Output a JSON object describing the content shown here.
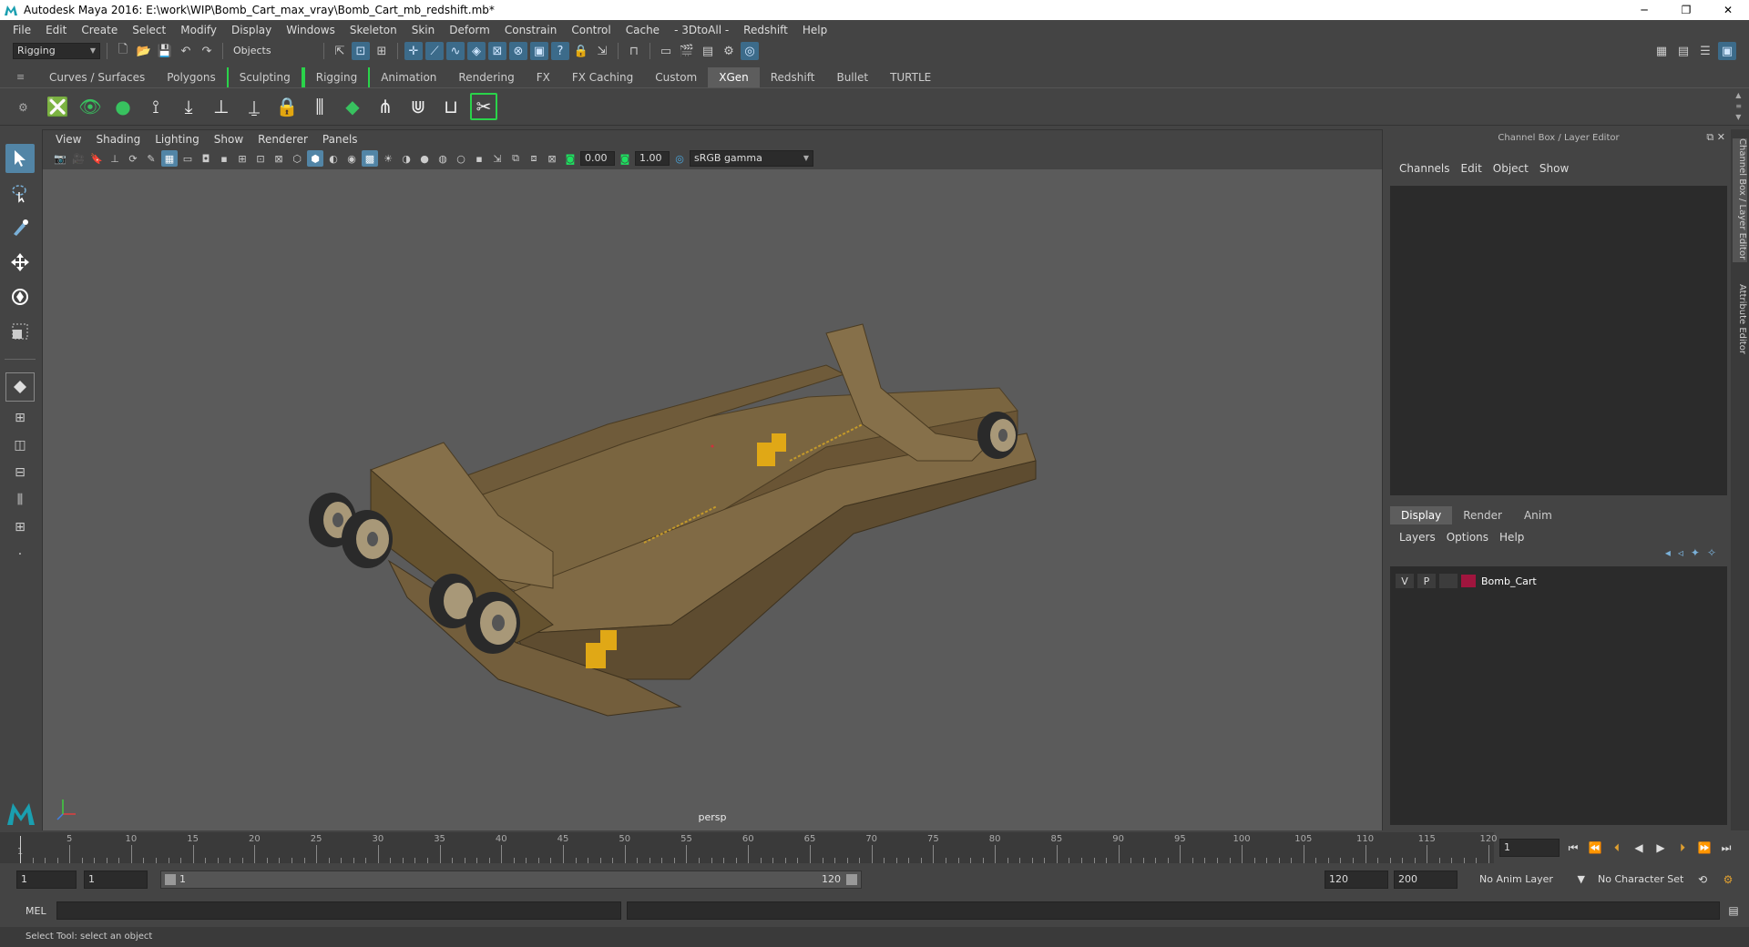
{
  "window": {
    "title": "Autodesk Maya 2016: E:\\work\\WIP\\Bomb_Cart_max_vray\\Bomb_Cart_mb_redshift.mb*",
    "minimize": "─",
    "restore": "❐",
    "close": "✕"
  },
  "menubar": [
    "File",
    "Edit",
    "Create",
    "Select",
    "Modify",
    "Display",
    "Windows",
    "Skeleton",
    "Skin",
    "Deform",
    "Constrain",
    "Control",
    "Cache",
    "- 3DtoAll -",
    "Redshift",
    "Help"
  ],
  "statusline": {
    "menuset": "Rigging",
    "selection_mode": "Objects"
  },
  "shelf_tabs": [
    {
      "label": "Curves / Surfaces",
      "active": false,
      "bracketed": false
    },
    {
      "label": "Polygons",
      "active": false,
      "bracketed": false
    },
    {
      "label": "Sculpting",
      "active": false,
      "bracketed": true
    },
    {
      "label": "Rigging",
      "active": false,
      "bracketed": true
    },
    {
      "label": "Animation",
      "active": false,
      "bracketed": false
    },
    {
      "label": "Rendering",
      "active": false,
      "bracketed": false
    },
    {
      "label": "FX",
      "active": false,
      "bracketed": false
    },
    {
      "label": "FX Caching",
      "active": false,
      "bracketed": false
    },
    {
      "label": "Custom",
      "active": false,
      "bracketed": false
    },
    {
      "label": "XGen",
      "active": true,
      "bracketed": false
    },
    {
      "label": "Redshift",
      "active": false,
      "bracketed": false
    },
    {
      "label": "Bullet",
      "active": false,
      "bracketed": false
    },
    {
      "label": "TURTLE",
      "active": false,
      "bracketed": false
    }
  ],
  "viewport": {
    "menu": [
      "View",
      "Shading",
      "Lighting",
      "Show",
      "Renderer",
      "Panels"
    ],
    "exposure": "0.00",
    "gamma": "1.00",
    "color_space": "sRGB gamma",
    "camera": "persp"
  },
  "channelbox": {
    "title": "Channel Box / Layer Editor",
    "menu": [
      "Channels",
      "Edit",
      "Object",
      "Show"
    ],
    "layer_tabs": [
      "Display",
      "Render",
      "Anim"
    ],
    "layer_menu": [
      "Layers",
      "Options",
      "Help"
    ],
    "layer": {
      "visible": "V",
      "playback": "P",
      "name": "Bomb_Cart",
      "color": "#a0153e"
    }
  },
  "side_tabs": [
    "Channel Box / Layer Editor",
    "Attribute Editor"
  ],
  "timeline": {
    "ticks": [
      5,
      10,
      15,
      20,
      25,
      30,
      35,
      40,
      45,
      50,
      55,
      60,
      65,
      70,
      75,
      80,
      85,
      90,
      95,
      100,
      105,
      110,
      115,
      120
    ],
    "start_marker": "1",
    "current_frame": "1"
  },
  "range": {
    "start": "1",
    "playback_start": "1",
    "slider_start": "1",
    "slider_end": "120",
    "playback_end": "120",
    "end": "200",
    "anim_layer": "No Anim Layer",
    "character_set": "No Character Set"
  },
  "command": {
    "label": "MEL"
  },
  "help_line": "Select Tool: select an object",
  "colors": {
    "accent": "#5285a6",
    "shelf_bracket": "#2ad34a",
    "cart_body": "#7a6540"
  }
}
